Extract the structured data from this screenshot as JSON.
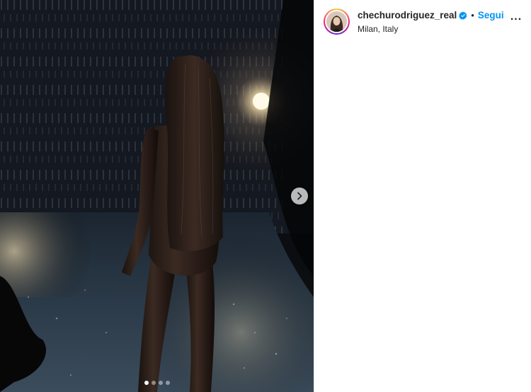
{
  "post": {
    "username": "chechurodriguez_real",
    "verified": true,
    "separator": "•",
    "follow_label": "Segui",
    "location": "Milan, Italy",
    "more_label": "..."
  },
  "carousel": {
    "slide_count": 4,
    "active_index": 0,
    "next_icon": "chevron-right-icon"
  },
  "colors": {
    "link_blue": "#0095f6",
    "text": "#262626",
    "verified_badge": "#0095f6"
  }
}
